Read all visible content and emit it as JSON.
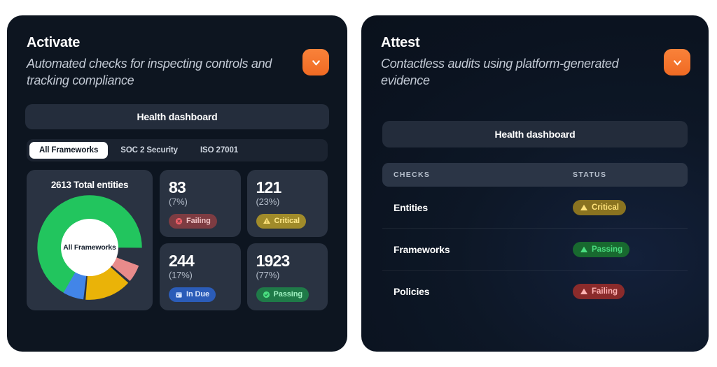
{
  "left": {
    "title": "Activate",
    "subtitle": "Automated checks for inspecting controls and tracking compliance",
    "chevron_icon": "chevron-down-icon",
    "health_dashboard_label": "Health dashboard",
    "tabs": [
      {
        "label": "All Frameworks",
        "active": true
      },
      {
        "label": "SOC 2 Security",
        "active": false
      },
      {
        "label": "ISO 27001",
        "active": false
      }
    ],
    "donut": {
      "total_label": "2613 Total entities",
      "center_label": "All Frameworks"
    },
    "stats": [
      {
        "value": "83",
        "percent": "(7%)",
        "badge": "Failing",
        "icon": "circle-x-icon",
        "variant": "failing"
      },
      {
        "value": "121",
        "percent": "(23%)",
        "badge": "Critical",
        "icon": "warning-triangle-icon",
        "variant": "critical"
      },
      {
        "value": "244",
        "percent": "(17%)",
        "badge": "In Due",
        "icon": "calendar-icon",
        "variant": "indue"
      },
      {
        "value": "1923",
        "percent": "(77%)",
        "badge": "Passing",
        "icon": "check-circle-icon",
        "variant": "passing"
      }
    ]
  },
  "right": {
    "title": "Attest",
    "subtitle": "Contactless audits using platform-generated evidence",
    "chevron_icon": "chevron-down-icon",
    "health_dashboard_label": "Health dashboard",
    "table": {
      "columns": [
        "CHECKS",
        "STATUS"
      ],
      "rows": [
        {
          "check": "Entities",
          "status": "Critical",
          "icon": "warning-triangle-icon",
          "variant": "critical"
        },
        {
          "check": "Frameworks",
          "status": "Passing",
          "icon": "warning-triangle-icon",
          "variant": "passing"
        },
        {
          "check": "Policies",
          "status": "Failing",
          "icon": "warning-triangle-icon",
          "variant": "failing"
        }
      ]
    }
  },
  "colors": {
    "accent_orange": "#f4762c",
    "passing_green": "#22c55e",
    "critical_yellow": "#eab308",
    "failing_red": "#e88b8b",
    "indue_blue": "#4285e8",
    "panel_bg": "#0d1520",
    "card_bg": "#2a3342"
  },
  "chart_data": {
    "type": "pie",
    "title": "2613 Total entities",
    "center_label": "All Frameworks",
    "categories": [
      "Passing",
      "Critical",
      "In Due",
      "Failing"
    ],
    "values": [
      1923,
      121,
      244,
      83
    ],
    "percents": [
      77,
      23,
      17,
      7
    ],
    "colors": [
      "#22c55e",
      "#eab308",
      "#4285e8",
      "#e88b8b"
    ],
    "total": 2613,
    "legend": "none",
    "donut": true
  }
}
